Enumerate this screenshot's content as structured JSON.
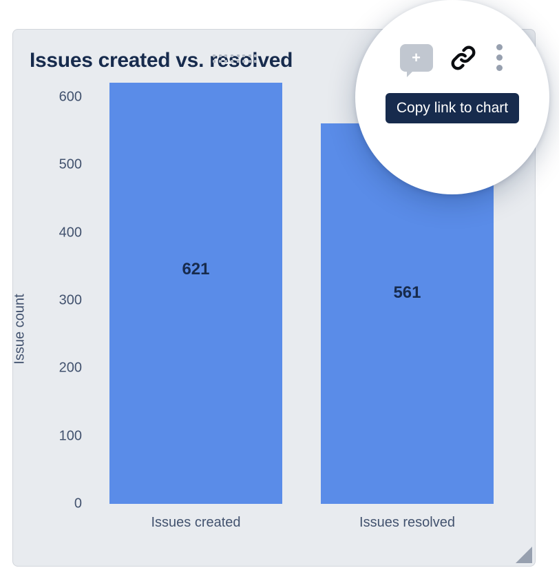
{
  "card": {
    "title": "Issues created vs. resolved"
  },
  "toolbar": {
    "tooltip": "Copy link to chart"
  },
  "chart_data": {
    "type": "bar",
    "title": "Issues created vs. resolved",
    "xlabel": "",
    "ylabel": "Issue count",
    "categories": [
      "Issues created",
      "Issues resolved"
    ],
    "values": [
      621,
      561
    ],
    "ylim": [
      0,
      600
    ],
    "yticks": [
      0,
      100,
      200,
      300,
      400,
      500,
      600
    ],
    "bar_color": "#5a8ce8"
  }
}
